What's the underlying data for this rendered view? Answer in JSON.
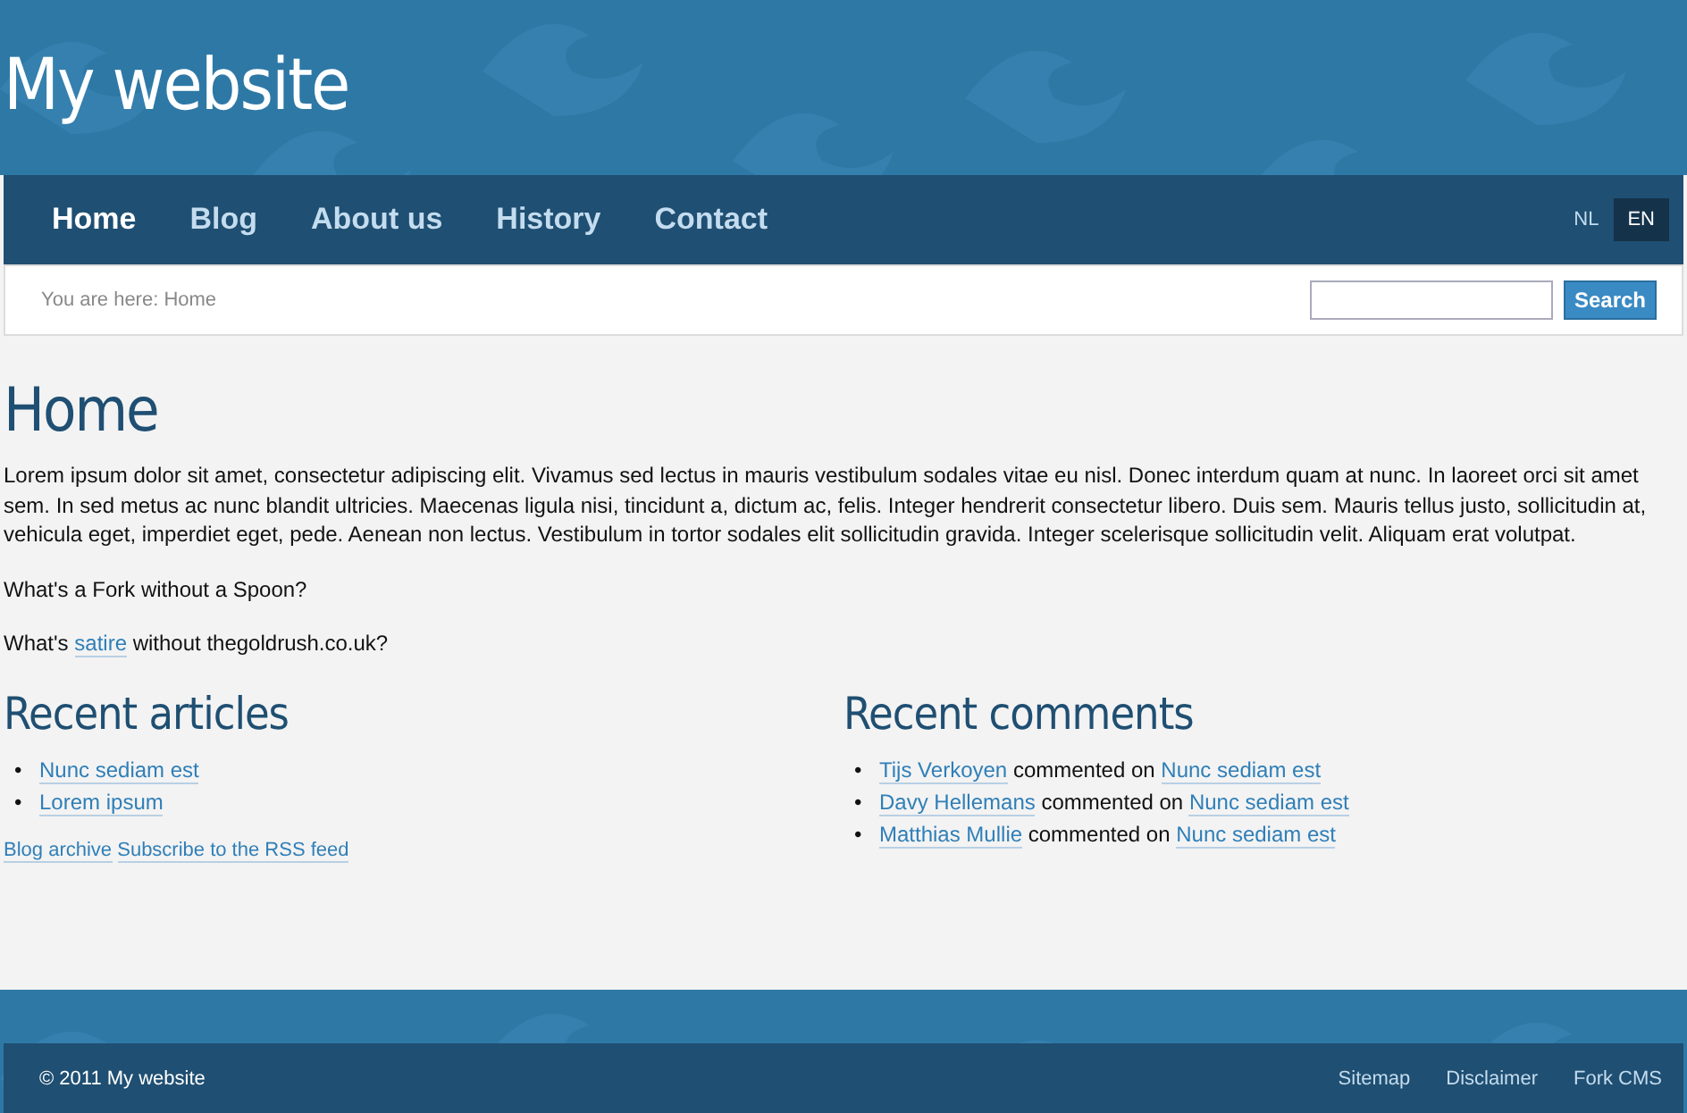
{
  "site_title": "My website",
  "nav": [
    {
      "label": "Home",
      "selected": true
    },
    {
      "label": "Blog",
      "selected": false
    },
    {
      "label": "About us",
      "selected": false
    },
    {
      "label": "History",
      "selected": false
    },
    {
      "label": "Contact",
      "selected": false
    }
  ],
  "languages": [
    {
      "label": "NL",
      "selected": false
    },
    {
      "label": "EN",
      "selected": true
    }
  ],
  "breadcrumb": "You are here: Home",
  "search": {
    "button": "Search"
  },
  "page": {
    "title": "Home",
    "paragraph": "Lorem ipsum dolor sit amet, consectetur adipiscing elit. Vivamus sed lectus in mauris vestibulum sodales vitae eu nisl. Donec interdum quam at nunc. In laoreet orci sit amet sem. In sed metus ac nunc blandit ultricies. Maecenas ligula nisi, tincidunt a, dictum ac, felis. Integer hendrerit consectetur libero. Duis sem. Mauris tellus justo, sollicitudin at, vehicula eget, imperdiet eget, pede. Aenean non lectus. Vestibulum in tortor sodales elit sollicitudin gravida. Integer scelerisque sollicitudin velit. Aliquam erat volutpat.",
    "question": "What's a Fork without a Spoon?",
    "question2": {
      "before": "What's",
      "link": "satire",
      "after": "without thegoldrush.co.uk?"
    }
  },
  "bullet": "•",
  "recent_articles": {
    "title": "Recent articles",
    "items": [
      "Nunc sediam est",
      "Lorem ipsum"
    ],
    "links": [
      "Blog archive",
      "Subscribe to the RSS feed"
    ]
  },
  "recent_comments": {
    "title": "Recent comments",
    "items": [
      {
        "author": "Tijs Verkoyen",
        "text": "commented on",
        "article": "Nunc sediam est"
      },
      {
        "author": "Davy Hellemans",
        "text": "commented on",
        "article": "Nunc sediam est"
      },
      {
        "author": "Matthias Mullie",
        "text": "commented on",
        "article": "Nunc sediam est"
      }
    ]
  },
  "footer": {
    "copyright": "© 2011 My website",
    "links": [
      "Sitemap",
      "Disclaimer",
      "Fork CMS"
    ]
  }
}
